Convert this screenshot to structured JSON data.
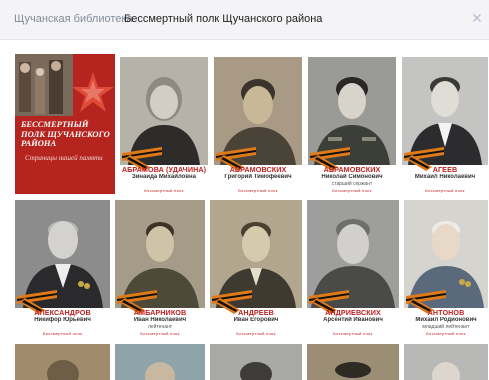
{
  "breadcrumb": {
    "library": "Щучанская библиотека",
    "separator": "›",
    "title": "Бессмертный полк Щучанского района",
    "close_icon": "close-icon"
  },
  "cover": {
    "title": "Бессмертный полк Щучанского района",
    "subtitle": "Страницы нашей памяти",
    "color": "#b5241f"
  },
  "cards": [
    {
      "name": "АБРАМОВА (УДАЧИНА)",
      "first": "Зинаида Михайловна",
      "rank": "",
      "logo": "Бессмертный полк"
    },
    {
      "name": "АБРАМОВСКИХ",
      "first": "Григорий Тимофеевич",
      "rank": "",
      "logo": "Бессмертный полк"
    },
    {
      "name": "АБРАМОВСКИХ",
      "first": "Николай Симонович",
      "rank": "старший сержант",
      "logo": "Бессмертный полк"
    },
    {
      "name": "АГЕЕВ",
      "first": "Михаил Николаевич",
      "rank": "",
      "logo": "Бессмертный полк"
    },
    {
      "name": "АЛЕКСАНДРОВ",
      "first": "Никифор Юрьевич",
      "rank": "",
      "logo": "Бессмертный полк"
    },
    {
      "name": "АМБАРНИКОВ",
      "first": "Иван Николаевич",
      "rank": "лейтенант",
      "logo": "Бессмертный полк"
    },
    {
      "name": "АНДРЕЕВ",
      "first": "Иван Егорович",
      "rank": "",
      "logo": "Бессмертный полк"
    },
    {
      "name": "АНДРИЕВСКИХ",
      "first": "Арсентий Иванович",
      "rank": "",
      "logo": "Бессмертный полк"
    },
    {
      "name": "АНТОНОВ",
      "first": "Михаил Родионович",
      "rank": "младший лейтенант",
      "logo": "Бессмертный полк"
    }
  ]
}
